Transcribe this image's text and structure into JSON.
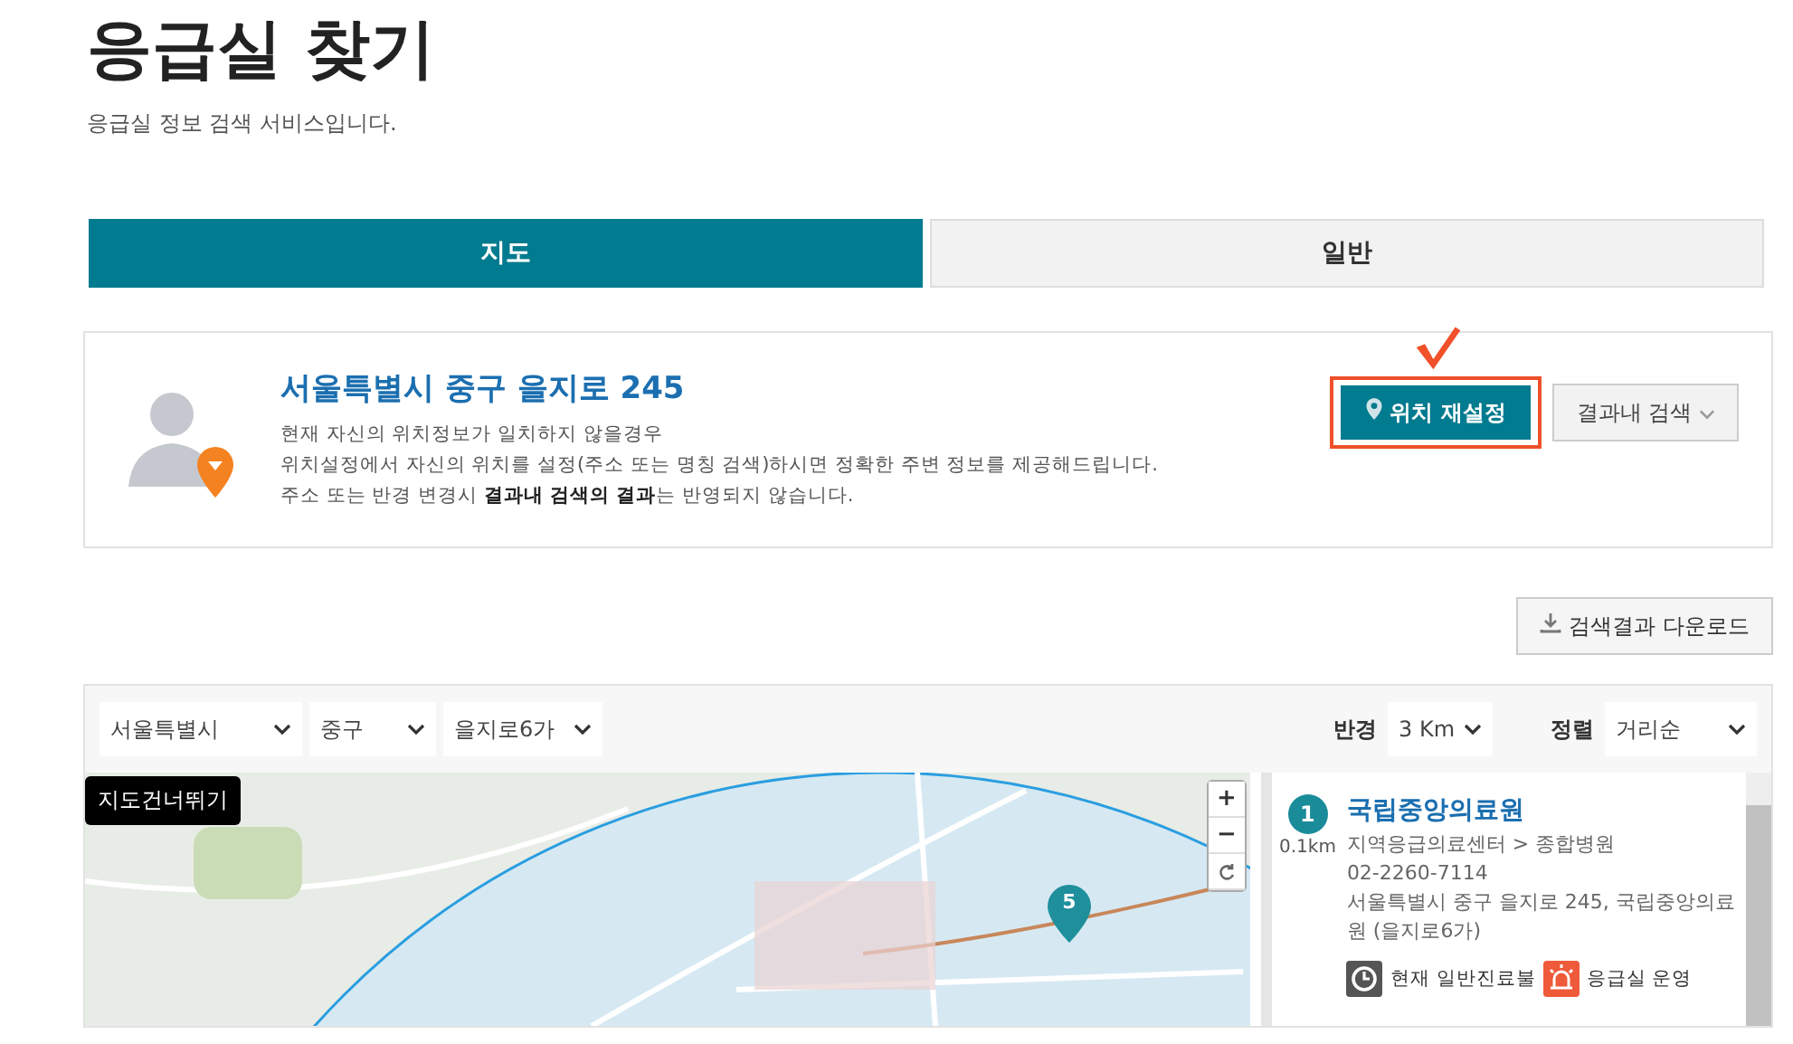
{
  "page": {
    "title": "응급실 찾기",
    "subtitle": "응급실 정보 검색 서비스입니다."
  },
  "tabs": [
    {
      "label": "지도",
      "selected": true
    },
    {
      "label": "일반",
      "selected": false
    }
  ],
  "location": {
    "address": "서울특별시 중구 을지로 245",
    "lines": [
      "현재 자신의 위치정보가 일치하지 않을경우",
      "위치설정에서 자신의 위치를 설정(주소 또는 명칭 검색)하시면 정확한 주변 정보를 제공해드립니다.",
      "주소 또는 반경 변경시 **결과내 검색의 결과**는 반영되지 않습니다."
    ],
    "reset_button": "위치 재설정",
    "reset_highlighted": true,
    "filter_button": "결과내 검색"
  },
  "download_button": "검색결과 다운로드",
  "filters": {
    "region": [
      "서울특별시",
      "중구",
      "을지로6가"
    ],
    "radius_label": "반경",
    "radius": "3 Km",
    "sort_label": "정렬",
    "sort": "거리순"
  },
  "map": {
    "skip_link": "지도건너뛰기",
    "zoom_in": "+",
    "zoom_out": "−",
    "marker": "5"
  },
  "results": [
    {
      "rank": "1",
      "distance": "0.1km",
      "name": "국립중앙의료원",
      "category": "지역응급의료센터 > 종합병원",
      "phone": "02-2260-7114",
      "address": "서울특별시 중구 을지로 245, 국립중앙의료원 (을지로6가)",
      "statuses": [
        {
          "kind": "clock",
          "label": "현재 일반진료불"
        },
        {
          "kind": "siren",
          "label": "응급실 운영"
        }
      ]
    }
  ]
}
